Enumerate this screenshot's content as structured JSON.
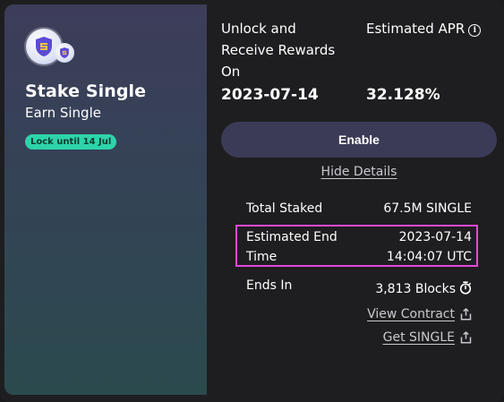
{
  "pool": {
    "title": "Stake Single",
    "subtitle": "Earn Single",
    "lock_badge": "Lock until 14 Jul"
  },
  "stats": {
    "unlock_label_line1": "Unlock and",
    "unlock_label_line2": "Receive Rewards",
    "unlock_label_line3": "On",
    "unlock_value": "2023-07-14",
    "apr_label": "Estimated APR",
    "apr_value": "32.128%"
  },
  "actions": {
    "enable_label": "Enable",
    "hide_details_label": "Hide Details"
  },
  "details": {
    "total_staked_label": "Total Staked",
    "total_staked_value": "67.5M SINGLE",
    "end_time_label_line1": "Estimated End",
    "end_time_label_line2": "Time",
    "end_time_date": "2023-07-14",
    "end_time_time": "14:04:07 UTC",
    "ends_in_label": "Ends In",
    "ends_in_value": "3,813 Blocks",
    "view_contract_label": "View Contract",
    "get_token_label": "Get SINGLE"
  },
  "colors": {
    "badge": "#2dd4aa",
    "button": "#3b3b58",
    "highlight": "#e04ad6"
  },
  "icons": [
    "single-token-icon",
    "single-token-small-icon",
    "info-icon",
    "timer-icon",
    "share-icon"
  ]
}
